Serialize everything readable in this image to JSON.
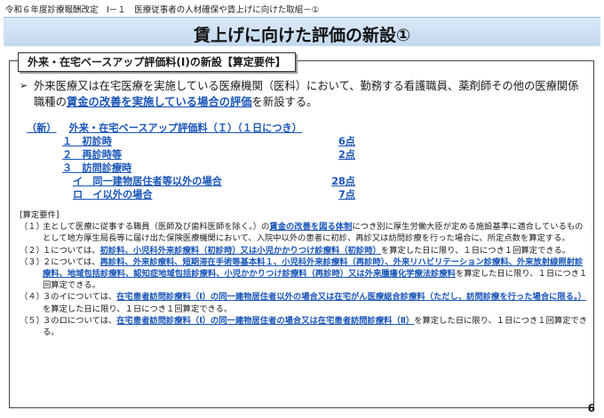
{
  "header": {
    "breadcrumb": "令和６年度診療報酬改定　Ⅰ－１　医療従事者の人材確保や賃上げに向けた取組－①"
  },
  "title": "賃上げに向けた評価の新設①",
  "section_label": "外来・在宅ベースアップ評価料(I)の新設【算定要件】",
  "intro": {
    "bullet": "➢",
    "before": "外来医療又は在宅医療を実施している医療機関（医科）において、勤務する看護職員、薬剤師その他の医療関係職種の",
    "highlight": "賃金の改善を実施している場合の評価",
    "after": "を新設する。"
  },
  "fee": {
    "new_tag": "（新）",
    "name": "外来・在宅ベースアップ評価料（Ｉ）（１日につき）",
    "items": [
      {
        "label": "１　初診時",
        "points": "6点"
      },
      {
        "label": "２　再診時等",
        "points": "2点"
      },
      {
        "label": "３　訪問診療時",
        "points": ""
      },
      {
        "label": "イ　同一建物居住者等以外の場合",
        "points": "28点"
      },
      {
        "label": "ロ　イ以外の場合",
        "points": "7点"
      }
    ]
  },
  "requirements": {
    "title": "[算定要件]",
    "items": [
      {
        "num": "（１）",
        "parts": [
          {
            "t": "主として医療に従事する職員（医師及び歯科医師を除く。）の",
            "b": false
          },
          {
            "t": "賃金の改善を図る体制",
            "b": true
          },
          {
            "t": "につき別に厚生労働大臣が定める施設基準に適合しているものとして地方厚生局長等に届け出た保険医療機関において、入院中以外の患者に初診、再診又は訪問診療を行った場合に、所定点数を算定する。",
            "b": false
          }
        ]
      },
      {
        "num": "（２）",
        "parts": [
          {
            "t": "１については、",
            "b": false
          },
          {
            "t": "初診料、小児科外来診療料（初診時）又は小児かかりつけ診療料（初診時）",
            "b": true
          },
          {
            "t": "を算定した日に限り、１日につき１回算定できる。",
            "b": false
          }
        ]
      },
      {
        "num": "（３）",
        "parts": [
          {
            "t": "２については、",
            "b": false
          },
          {
            "t": "再診料、外来診療料、短期滞在手術等基本料１、小児科外来診療料（再診時）、外来リハビリテーション診療料、外来放射線照射診療料、地域包括診療料、認知症地域包括診療料、小児かかりつけ診療料（再診時）又は外来腫瘍化学療法診療料",
            "b": true
          },
          {
            "t": "を算定した日に限り、１日につき１回算定できる。",
            "b": false
          }
        ]
      },
      {
        "num": "（４）",
        "parts": [
          {
            "t": "３のイについては、",
            "b": false
          },
          {
            "t": "在宅患者訪問診療料（Ⅰ）の同一建物居住者以外の場合又は在宅がん医療総合診療料（ただし、訪問診療を行った場合に限る。）",
            "b": true
          },
          {
            "t": "を算定した日に限り、１日につき１回算定できる。",
            "b": false
          }
        ]
      },
      {
        "num": "（５）",
        "parts": [
          {
            "t": "３のロについては、",
            "b": false
          },
          {
            "t": "在宅患者訪問診療料（Ⅰ）の同一建物居住者の場合又は在宅患者訪問診療料（Ⅱ）",
            "b": true
          },
          {
            "t": "を算定した日に限り、１日につき１回算定できる。",
            "b": false
          }
        ]
      }
    ]
  },
  "page_number": "6"
}
